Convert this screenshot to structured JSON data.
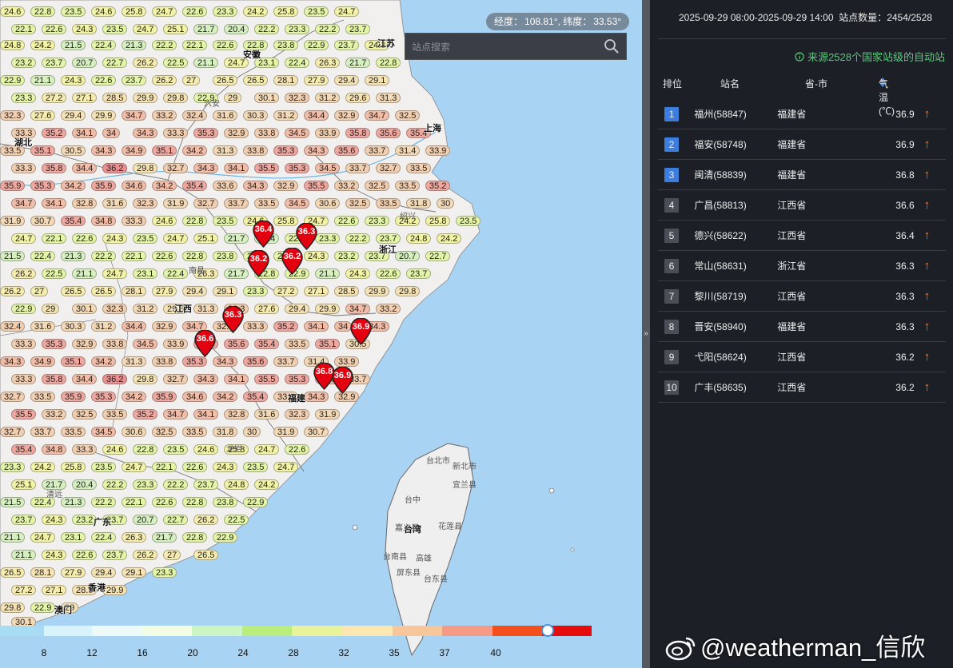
{
  "header": {
    "time_range": "2025-09-29 08:00-2025-09-29 14:00",
    "station_count_label": "站点数量：",
    "station_count": "2454/2528",
    "source_note": "来源2528个国家站级的自动站"
  },
  "map": {
    "coord_lon_label": "经度：",
    "coord_lon": "108.81°",
    "coord_lat_label": "纬度：",
    "coord_lat": "33.53°",
    "search_placeholder": "站点搜索",
    "places": [
      {
        "name": "安徽",
        "cls": ""
      },
      {
        "name": "江苏",
        "cls": ""
      },
      {
        "name": "上海",
        "cls": ""
      },
      {
        "name": "湖北",
        "cls": ""
      },
      {
        "name": "浙江",
        "cls": ""
      },
      {
        "name": "江西",
        "cls": ""
      },
      {
        "name": "福建",
        "cls": ""
      },
      {
        "name": "广东",
        "cls": ""
      },
      {
        "name": "香港",
        "cls": ""
      },
      {
        "name": "澳门",
        "cls": ""
      },
      {
        "name": "台湾",
        "cls": ""
      },
      {
        "name": "台北市",
        "cls": "light"
      },
      {
        "name": "新北市",
        "cls": "light"
      },
      {
        "name": "台中",
        "cls": "light"
      },
      {
        "name": "台南县",
        "cls": "light"
      },
      {
        "name": "宜兰县",
        "cls": "light"
      },
      {
        "name": "嘉义县",
        "cls": "light"
      },
      {
        "name": "屏东县",
        "cls": "light"
      },
      {
        "name": "高雄",
        "cls": "light"
      },
      {
        "name": "台东县",
        "cls": "light"
      },
      {
        "name": "花莲县",
        "cls": "light"
      },
      {
        "name": "绍兴",
        "cls": "light"
      },
      {
        "name": "南昌",
        "cls": "light"
      },
      {
        "name": "龙岩",
        "cls": "light"
      },
      {
        "name": "清远",
        "cls": "light"
      },
      {
        "name": "六安",
        "cls": "light"
      }
    ],
    "markers": [
      "36.4",
      "36.3",
      "36.2",
      "36.2",
      "36.3",
      "36.6",
      "36.9",
      "36.8",
      "36.9"
    ],
    "stations": [
      "24.6",
      "22.8",
      "23.5",
      "24.6",
      "25.8",
      "24.7",
      "22.6",
      "23.3",
      "24.2",
      "25.8",
      "23.5",
      "24.7",
      "22.1",
      "22.6",
      "24.3",
      "23.5",
      "24.7",
      "25.1",
      "21.7",
      "20.4",
      "22.2",
      "23.3",
      "22.2",
      "23.7",
      "24.8",
      "24.2",
      "21.5",
      "22.4",
      "21.3",
      "22.2",
      "22.1",
      "22.6",
      "22.8",
      "23.8",
      "22.9",
      "23.7",
      "24.3",
      "23.2",
      "23.7",
      "20.7",
      "22.7",
      "26.2",
      "22.5",
      "21.1",
      "24.7",
      "23.1",
      "22.4",
      "26.3",
      "21.7",
      "22.8",
      "22.9",
      "21.1",
      "24.3",
      "22.6",
      "23.7",
      "26.2",
      "27",
      "26.5",
      "26.5",
      "28.1",
      "27.9",
      "29.4",
      "29.1",
      "23.3",
      "27.2",
      "27.1",
      "28.5",
      "29.9",
      "29.8",
      "22.9",
      "29",
      "30.1",
      "32.3",
      "31.2",
      "29.6",
      "31.3",
      "32.3",
      "27.6",
      "29.4",
      "29.9",
      "34.7",
      "33.2",
      "32.4",
      "31.6",
      "30.3",
      "31.2",
      "34.4",
      "32.9",
      "34.7",
      "32.5",
      "33.3",
      "35.2",
      "34.1",
      "34",
      "34.3",
      "33.3",
      "35.3",
      "32.9",
      "33.8",
      "34.5",
      "33.9",
      "35.8",
      "35.6",
      "35.4",
      "33.5",
      "35.1",
      "30.5",
      "34.3",
      "34.9",
      "35.1",
      "34.2",
      "31.3",
      "33.8",
      "35.3",
      "34.3",
      "35.6",
      "33.7",
      "31.4",
      "33.9",
      "33.3",
      "35.8",
      "34.4",
      "36.2",
      "29.8",
      "32.7",
      "34.3",
      "34.1",
      "35.5",
      "35.3",
      "34.5",
      "33.7",
      "32.7",
      "33.5",
      "35.9",
      "35.3",
      "34.2",
      "35.9",
      "34.6",
      "34.2",
      "35.4",
      "33.6",
      "34.3",
      "32.9",
      "35.5",
      "33.2",
      "32.5",
      "33.5",
      "35.2",
      "34.7",
      "34.1",
      "32.8",
      "31.6",
      "32.3",
      "31.9",
      "32.7",
      "33.7",
      "33.5",
      "34.5",
      "30.6",
      "32.5",
      "33.5",
      "31.8",
      "30",
      "31.9",
      "30.7",
      "35.4",
      "34.8",
      "33.3"
    ]
  },
  "legend": {
    "ticks": [
      "8",
      "12",
      "16",
      "20",
      "24",
      "28",
      "32",
      "35",
      "37",
      "40"
    ],
    "colors": [
      "#a8dcf5",
      "#d9f3fb",
      "#eefaf8",
      "#f3fce4",
      "#cbf5c2",
      "#b9ed7c",
      "#e9f49a",
      "#fce7b2",
      "#f7c79b",
      "#f49a86",
      "#f5501c",
      "#e60c0c"
    ]
  },
  "table": {
    "headers": {
      "rank": "排位",
      "name": "站名",
      "province": "省-市",
      "temp": "气温(℃)"
    },
    "rows": [
      {
        "rank": "1",
        "name": "福州(58847)",
        "province": "福建省",
        "temp": "36.9",
        "arrow": "↑",
        "badge": "#3c7de0"
      },
      {
        "rank": "2",
        "name": "福安(58748)",
        "province": "福建省",
        "temp": "36.9",
        "arrow": "↑",
        "badge": "#3c7de0"
      },
      {
        "rank": "3",
        "name": "闽清(58839)",
        "province": "福建省",
        "temp": "36.8",
        "arrow": "↑",
        "badge": "#3c7de0"
      },
      {
        "rank": "4",
        "name": "广昌(58813)",
        "province": "江西省",
        "temp": "36.6",
        "arrow": "↑",
        "badge": "#4a4f57"
      },
      {
        "rank": "5",
        "name": "德兴(58622)",
        "province": "江西省",
        "temp": "36.4",
        "arrow": "↑",
        "badge": "#4a4f57"
      },
      {
        "rank": "6",
        "name": "常山(58631)",
        "province": "浙江省",
        "temp": "36.3",
        "arrow": "↑",
        "badge": "#4a4f57"
      },
      {
        "rank": "7",
        "name": "黎川(58719)",
        "province": "江西省",
        "temp": "36.3",
        "arrow": "↑",
        "badge": "#4a4f57"
      },
      {
        "rank": "8",
        "name": "晋安(58940)",
        "province": "福建省",
        "temp": "36.3",
        "arrow": "↑",
        "badge": "#4a4f57"
      },
      {
        "rank": "9",
        "name": "弋阳(58624)",
        "province": "江西省",
        "temp": "36.2",
        "arrow": "↑",
        "badge": "#4a4f57"
      },
      {
        "rank": "10",
        "name": "广丰(58635)",
        "province": "江西省",
        "temp": "36.2",
        "arrow": "↑",
        "badge": "#4a4f57"
      }
    ]
  },
  "watermark": "@weatherman_信欣"
}
